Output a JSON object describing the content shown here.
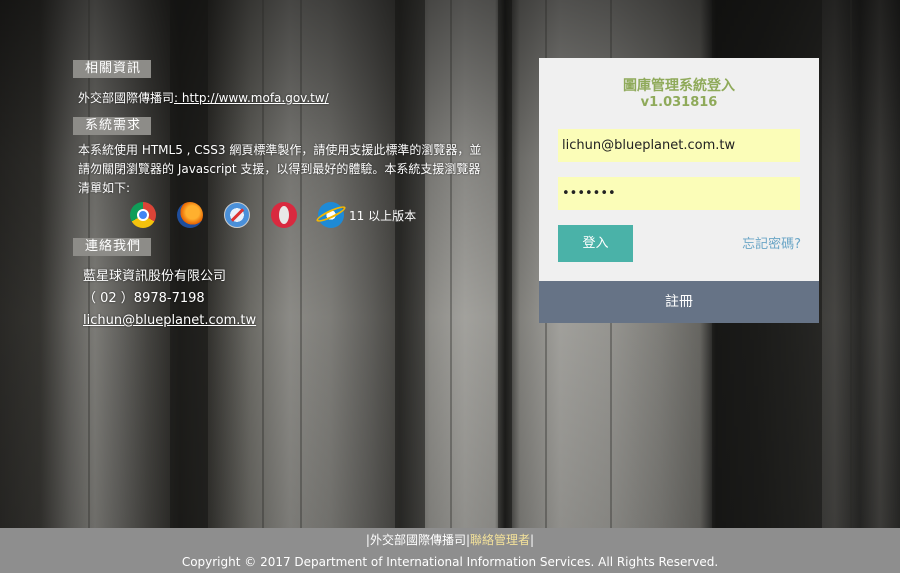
{
  "info": {
    "related_tag": "相關資訊",
    "mofa_prefix": "外交部國際傳播司",
    "mofa_link": ": http://www.mofa.gov.tw/",
    "requirements_tag": "系統需求",
    "requirements_line1": "本系統使用 HTML5 , CSS3 網頁標準製作，請使用支援此標準的瀏覽器，並",
    "requirements_line2": "請勿關閉瀏覽器的 Javascript 支援，以得到最好的體驗。本系統支援瀏覽器",
    "requirements_line3": "清單如下:",
    "browsers": [
      "chrome-icon",
      "firefox-icon",
      "safari-icon",
      "opera-icon",
      "ie-icon"
    ],
    "ie_version": "11 以上版本",
    "contact_tag": "連絡我們",
    "company": "藍星球資訊股份有限公司",
    "phone": "（ 02 ）8978-7198",
    "email": "lichun@blueplanet.com.tw"
  },
  "login": {
    "title": "圖庫管理系統登入",
    "version": "v1.031816",
    "username_value": "lichun@blueplanet.com.tw",
    "password_value": "•••••••",
    "login_label": "登入",
    "forgot_label": "忘記密碼?",
    "register_label": "註冊",
    "accent_color": "#4ab2a8",
    "title_color": "#8faa5a",
    "register_color": "#667386"
  },
  "footer": {
    "sep1": "|",
    "link1": "外交部國際傳播司",
    "sep2": "|",
    "link2": "聯絡管理者",
    "sep3": "|",
    "copyright": "Copyright © 2017 Department of International Information Services. All Rights Reserved."
  }
}
